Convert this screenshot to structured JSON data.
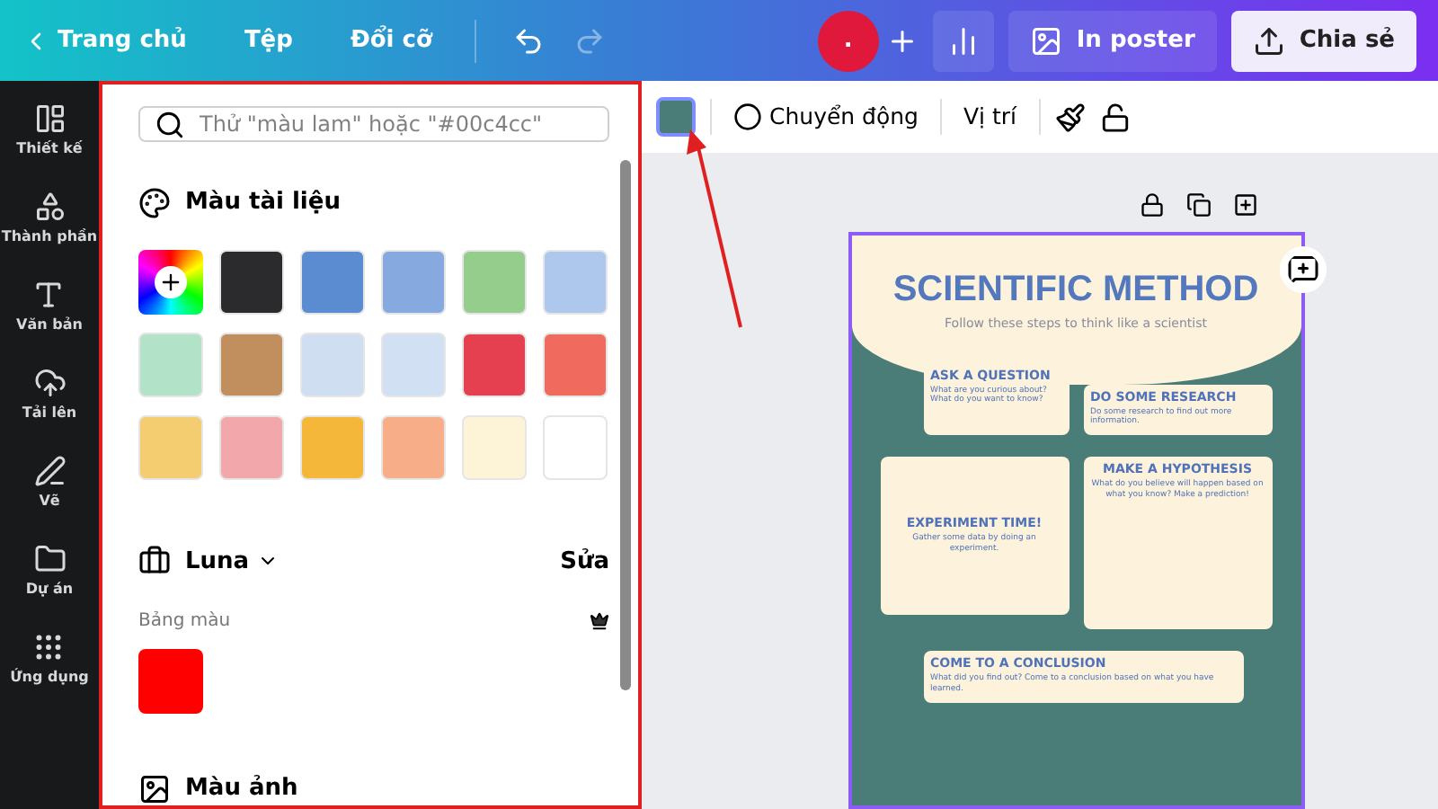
{
  "topbar": {
    "back": "Trang chủ",
    "menu": [
      "Tệp",
      "Đổi cỡ"
    ],
    "avatar": ".",
    "print": "In poster",
    "share": "Chia sẻ"
  },
  "rail": [
    {
      "kind": "layout",
      "label": "Thiết kế"
    },
    {
      "kind": "shapes",
      "label": "Thành phần"
    },
    {
      "kind": "text",
      "label": "Văn bản"
    },
    {
      "kind": "upload",
      "label": "Tải lên"
    },
    {
      "kind": "draw",
      "label": "Vẽ"
    },
    {
      "kind": "folder",
      "label": "Dự án"
    },
    {
      "kind": "apps",
      "label": "Ứng dụng"
    }
  ],
  "panel": {
    "search": {
      "placeholder": "Thử \"màu lam\" hoặc \"#00c4cc\""
    },
    "document_colors": {
      "title": "Màu tài liệu",
      "swatches": [
        {
          "kind": "add"
        },
        {
          "kind": "color",
          "color": "#2b2b2d"
        },
        {
          "kind": "color",
          "color": "#5b8bd0"
        },
        {
          "kind": "color",
          "color": "#86a9e0"
        },
        {
          "kind": "color",
          "color": "#95cd8c"
        },
        {
          "kind": "color",
          "color": "#adc8ec"
        },
        {
          "kind": "color",
          "color": "#b2e3c8"
        },
        {
          "kind": "color",
          "color": "#c18f5d"
        },
        {
          "kind": "color",
          "color": "#cfdff1"
        },
        {
          "kind": "color",
          "color": "#d1e1f3"
        },
        {
          "kind": "color",
          "color": "#e5404f"
        },
        {
          "kind": "color",
          "color": "#f06a5d"
        },
        {
          "kind": "color",
          "color": "#f4cd70"
        },
        {
          "kind": "color",
          "color": "#f2a8ab"
        },
        {
          "kind": "color",
          "color": "#f4b73a"
        },
        {
          "kind": "color",
          "color": "#f7ad88"
        },
        {
          "kind": "color",
          "color": "#fdf4d8"
        },
        {
          "kind": "color",
          "color": "#ffffff"
        }
      ]
    },
    "brand_kit": {
      "name": "Luna",
      "edit": "Sửa",
      "palette_label": "Bảng màu",
      "palette": [
        {
          "color": "#ff0000"
        }
      ]
    },
    "photo_colors": {
      "title": "Màu ảnh"
    }
  },
  "toolbar": {
    "swatch": {
      "color": "#4a7c78"
    },
    "animate": "Chuyển động",
    "position": "Vị trí"
  },
  "poster": {
    "title": "SCIENTIFIC METHOD",
    "subtitle": "Follow these steps to think like a scientist",
    "cards": [
      {
        "title": "ASK A QUESTION",
        "body": "What are you curious about? What do you want to know?"
      },
      {
        "title": "DO SOME RESEARCH",
        "body": "Do some research to find out more information."
      },
      {
        "title": "EXPERIMENT TIME!",
        "body": "Gather some data by doing an experiment."
      },
      {
        "title": "MAKE A HYPOTHESIS",
        "body": "What do you believe will happen based on what you know? Make a prediction!"
      },
      {
        "title": "COME TO A CONCLUSION",
        "body": "What did you find out? Come to a conclusion based on what you have learned."
      }
    ]
  }
}
